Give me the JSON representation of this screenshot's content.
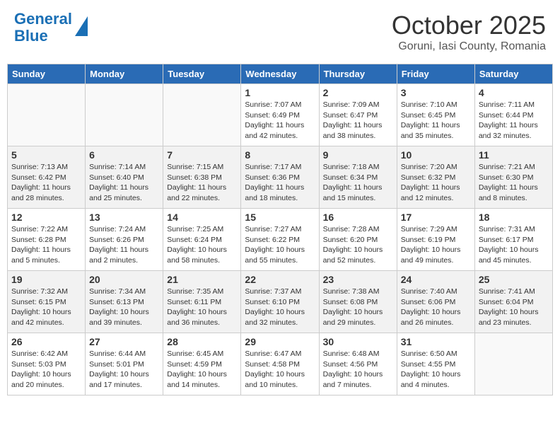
{
  "header": {
    "logo_line1": "General",
    "logo_line2": "Blue",
    "month_title": "October 2025",
    "location": "Goruni, Iasi County, Romania"
  },
  "calendar": {
    "days_of_week": [
      "Sunday",
      "Monday",
      "Tuesday",
      "Wednesday",
      "Thursday",
      "Friday",
      "Saturday"
    ],
    "weeks": [
      [
        {
          "day": "",
          "info": ""
        },
        {
          "day": "",
          "info": ""
        },
        {
          "day": "",
          "info": ""
        },
        {
          "day": "1",
          "info": "Sunrise: 7:07 AM\nSunset: 6:49 PM\nDaylight: 11 hours and 42 minutes."
        },
        {
          "day": "2",
          "info": "Sunrise: 7:09 AM\nSunset: 6:47 PM\nDaylight: 11 hours and 38 minutes."
        },
        {
          "day": "3",
          "info": "Sunrise: 7:10 AM\nSunset: 6:45 PM\nDaylight: 11 hours and 35 minutes."
        },
        {
          "day": "4",
          "info": "Sunrise: 7:11 AM\nSunset: 6:44 PM\nDaylight: 11 hours and 32 minutes."
        }
      ],
      [
        {
          "day": "5",
          "info": "Sunrise: 7:13 AM\nSunset: 6:42 PM\nDaylight: 11 hours and 28 minutes."
        },
        {
          "day": "6",
          "info": "Sunrise: 7:14 AM\nSunset: 6:40 PM\nDaylight: 11 hours and 25 minutes."
        },
        {
          "day": "7",
          "info": "Sunrise: 7:15 AM\nSunset: 6:38 PM\nDaylight: 11 hours and 22 minutes."
        },
        {
          "day": "8",
          "info": "Sunrise: 7:17 AM\nSunset: 6:36 PM\nDaylight: 11 hours and 18 minutes."
        },
        {
          "day": "9",
          "info": "Sunrise: 7:18 AM\nSunset: 6:34 PM\nDaylight: 11 hours and 15 minutes."
        },
        {
          "day": "10",
          "info": "Sunrise: 7:20 AM\nSunset: 6:32 PM\nDaylight: 11 hours and 12 minutes."
        },
        {
          "day": "11",
          "info": "Sunrise: 7:21 AM\nSunset: 6:30 PM\nDaylight: 11 hours and 8 minutes."
        }
      ],
      [
        {
          "day": "12",
          "info": "Sunrise: 7:22 AM\nSunset: 6:28 PM\nDaylight: 11 hours and 5 minutes."
        },
        {
          "day": "13",
          "info": "Sunrise: 7:24 AM\nSunset: 6:26 PM\nDaylight: 11 hours and 2 minutes."
        },
        {
          "day": "14",
          "info": "Sunrise: 7:25 AM\nSunset: 6:24 PM\nDaylight: 10 hours and 58 minutes."
        },
        {
          "day": "15",
          "info": "Sunrise: 7:27 AM\nSunset: 6:22 PM\nDaylight: 10 hours and 55 minutes."
        },
        {
          "day": "16",
          "info": "Sunrise: 7:28 AM\nSunset: 6:20 PM\nDaylight: 10 hours and 52 minutes."
        },
        {
          "day": "17",
          "info": "Sunrise: 7:29 AM\nSunset: 6:19 PM\nDaylight: 10 hours and 49 minutes."
        },
        {
          "day": "18",
          "info": "Sunrise: 7:31 AM\nSunset: 6:17 PM\nDaylight: 10 hours and 45 minutes."
        }
      ],
      [
        {
          "day": "19",
          "info": "Sunrise: 7:32 AM\nSunset: 6:15 PM\nDaylight: 10 hours and 42 minutes."
        },
        {
          "day": "20",
          "info": "Sunrise: 7:34 AM\nSunset: 6:13 PM\nDaylight: 10 hours and 39 minutes."
        },
        {
          "day": "21",
          "info": "Sunrise: 7:35 AM\nSunset: 6:11 PM\nDaylight: 10 hours and 36 minutes."
        },
        {
          "day": "22",
          "info": "Sunrise: 7:37 AM\nSunset: 6:10 PM\nDaylight: 10 hours and 32 minutes."
        },
        {
          "day": "23",
          "info": "Sunrise: 7:38 AM\nSunset: 6:08 PM\nDaylight: 10 hours and 29 minutes."
        },
        {
          "day": "24",
          "info": "Sunrise: 7:40 AM\nSunset: 6:06 PM\nDaylight: 10 hours and 26 minutes."
        },
        {
          "day": "25",
          "info": "Sunrise: 7:41 AM\nSunset: 6:04 PM\nDaylight: 10 hours and 23 minutes."
        }
      ],
      [
        {
          "day": "26",
          "info": "Sunrise: 6:42 AM\nSunset: 5:03 PM\nDaylight: 10 hours and 20 minutes."
        },
        {
          "day": "27",
          "info": "Sunrise: 6:44 AM\nSunset: 5:01 PM\nDaylight: 10 hours and 17 minutes."
        },
        {
          "day": "28",
          "info": "Sunrise: 6:45 AM\nSunset: 4:59 PM\nDaylight: 10 hours and 14 minutes."
        },
        {
          "day": "29",
          "info": "Sunrise: 6:47 AM\nSunset: 4:58 PM\nDaylight: 10 hours and 10 minutes."
        },
        {
          "day": "30",
          "info": "Sunrise: 6:48 AM\nSunset: 4:56 PM\nDaylight: 10 hours and 7 minutes."
        },
        {
          "day": "31",
          "info": "Sunrise: 6:50 AM\nSunset: 4:55 PM\nDaylight: 10 hours and 4 minutes."
        },
        {
          "day": "",
          "info": ""
        }
      ]
    ]
  }
}
